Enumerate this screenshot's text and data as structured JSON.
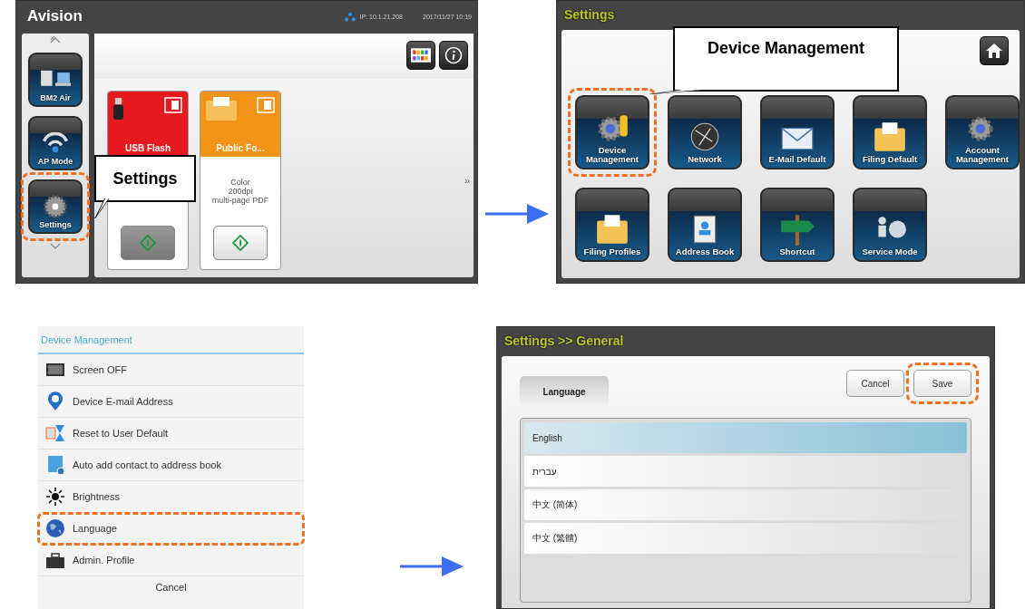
{
  "home_screen": {
    "logo": "Avision",
    "ip": "IP: 10.1.21.208",
    "datetime": "2017/11/27 10:19",
    "sidebar": [
      {
        "label": "BM2 Air",
        "highlighted": false
      },
      {
        "label": "AP Mode",
        "highlighted": false
      },
      {
        "label": "Settings",
        "highlighted": true
      }
    ],
    "cards": [
      {
        "title": "USB Flash",
        "color": "#e51a1f",
        "pressed": true
      },
      {
        "title": "Public Fo...",
        "color": "#f29418",
        "description": [
          "Color",
          "200dpi",
          "multi-page PDF"
        ],
        "pressed": false
      }
    ],
    "next_page": "»",
    "callout": "Settings"
  },
  "settings_screen": {
    "title": "Settings",
    "callout": "Device Management",
    "tiles": [
      {
        "label": "Device Management",
        "highlighted": true
      },
      {
        "label": "Network",
        "highlighted": false
      },
      {
        "label": "E-Mail Default",
        "highlighted": false
      },
      {
        "label": "Filing Default",
        "highlighted": false
      },
      {
        "label": "Account Management",
        "highlighted": false
      },
      {
        "label": "Filing Profiles",
        "highlighted": false
      },
      {
        "label": "Address Book",
        "highlighted": false
      },
      {
        "label": "Shortcut",
        "highlighted": false
      },
      {
        "label": "Service Mode",
        "highlighted": false
      }
    ]
  },
  "device_management_menu": {
    "title": "Device Management",
    "items": [
      {
        "label": "Screen OFF",
        "highlighted": false
      },
      {
        "label": "Device E-mail Address",
        "highlighted": false
      },
      {
        "label": "Reset to User Default",
        "highlighted": false
      },
      {
        "label": "Auto add contact to address book",
        "highlighted": false
      },
      {
        "label": "Brightness",
        "highlighted": false
      },
      {
        "label": "Language",
        "highlighted": true
      },
      {
        "label": "Admin. Profile",
        "highlighted": false
      }
    ],
    "cancel": "Cancel"
  },
  "language_screen": {
    "title": "Settings >> General",
    "tab": "Language",
    "buttons": [
      {
        "label": "Cancel",
        "highlighted": false
      },
      {
        "label": "Save",
        "highlighted": true
      }
    ],
    "languages": [
      {
        "label": "English",
        "selected": true
      },
      {
        "label": "עברית",
        "selected": false
      },
      {
        "label": "中文 (简体)",
        "selected": false
      },
      {
        "label": "中文 (繁體)",
        "selected": false
      }
    ]
  }
}
